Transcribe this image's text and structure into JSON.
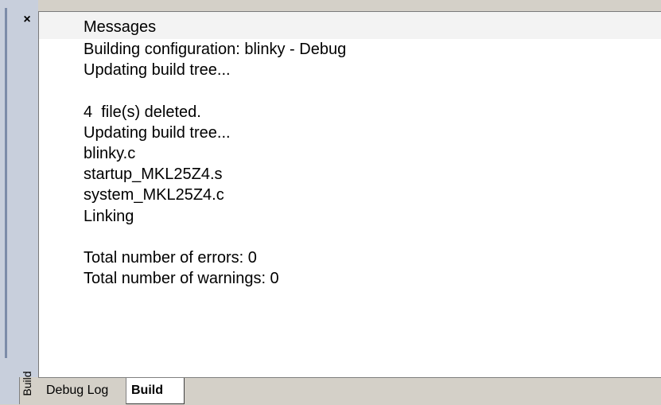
{
  "window": {
    "close_glyph": "×",
    "title": "Build"
  },
  "messages": {
    "header": "Messages",
    "lines": [
      "Building configuration: blinky - Debug",
      "Updating build tree...",
      "",
      "4  file(s) deleted.",
      "Updating build tree...",
      "blinky.c",
      "startup_MKL25Z4.s",
      "system_MKL25Z4.c",
      "Linking",
      "",
      "Total number of errors: 0",
      "Total number of warnings: 0"
    ]
  },
  "tabs": [
    {
      "label": "Debug Log",
      "active": false
    },
    {
      "label": "Build",
      "active": true
    }
  ]
}
